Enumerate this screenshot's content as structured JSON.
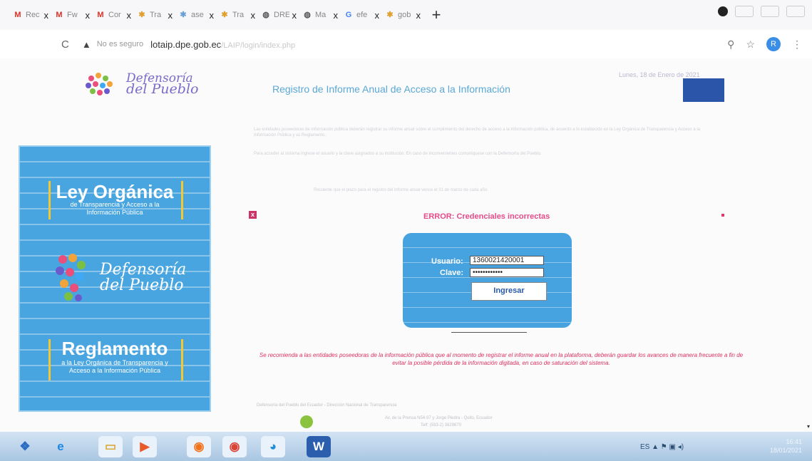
{
  "browser": {
    "tabs": [
      {
        "icon": "gmail-icon",
        "label": "Rec",
        "glyph": "M",
        "color": "#d93025"
      },
      {
        "icon": "gmail-icon",
        "label": "Fw",
        "glyph": "M",
        "color": "#d93025"
      },
      {
        "icon": "gmail-icon",
        "label": "Cor",
        "glyph": "M",
        "color": "#d93025"
      },
      {
        "icon": "site-icon",
        "label": "Tra",
        "glyph": "✱",
        "color": "#e0a030"
      },
      {
        "icon": "site-icon",
        "label": "ase",
        "glyph": "✱",
        "color": "#6aa0d8"
      },
      {
        "icon": "site-icon",
        "label": "Tra",
        "glyph": "✱",
        "color": "#e0a030"
      },
      {
        "icon": "globe-icon",
        "label": "DRE",
        "glyph": "◍",
        "color": "#555555"
      },
      {
        "icon": "globe-icon",
        "label": "Ma",
        "glyph": "◍",
        "color": "#555555"
      },
      {
        "icon": "google-icon",
        "label": "efe",
        "glyph": "G",
        "color": "#4285f4"
      },
      {
        "icon": "site-icon",
        "label": "gob",
        "glyph": "✱",
        "color": "#e0a030"
      }
    ],
    "tab_close": "x",
    "new_tab": "+",
    "reload": "C",
    "security_icon": "▲",
    "security_text": "No es seguro",
    "url_domain": "lotaip.dpe.gob.ec",
    "url_path": "/LAIP/login/index.php",
    "search_icon": "⚲",
    "star_icon": "☆",
    "profile_initial": "R",
    "menu_icon": "⋮"
  },
  "header": {
    "logo_line1": "Defensoría",
    "logo_line2": "del Pueblo",
    "title": "Registro de Informe Anual de Acceso a la Información",
    "date": "Lunes, 18 de Enero de 2021"
  },
  "paragraphs": [
    "Las entidades poseedoras de información pública deberán registrar su informe anual sobre el cumplimiento del derecho de acceso a la información pública, de acuerdo a lo establecido en la Ley Orgánica de Transparencia y Acceso a la Información Pública y su Reglamento.",
    "Para acceder al sistema ingrese el usuario y la clave asignados a su institución. En caso de inconvenientes comuníquese con la Defensoría del Pueblo.",
    "Recuerde que el plazo para el registro del informe anual vence el 31 de marzo de cada año."
  ],
  "banner": {
    "law_title": "Ley Orgánica",
    "law_subtitle": "de Transparencia y Acceso a la Información Pública",
    "brand_line1": "Defensoría",
    "brand_line2": "del Pueblo",
    "reg_title": "Reglamento",
    "reg_subtitle": "a la Ley Orgánica de Transparencia y Acceso a la Información Pública"
  },
  "error": {
    "close_glyph": "x",
    "message": "ERROR: Credenciales incorrectas"
  },
  "login": {
    "user_label": "Usuario:",
    "user_value": "1360021420001",
    "password_label": "Clave:",
    "password_value": "••••••••••••",
    "submit_label": "Ingresar"
  },
  "note": "Se recomienda a las entidades poseedoras de la información pública que al momento de registrar el informe anual en la plataforma, deberán guardar los avances de manera frecuente a fin de evitar la posible pérdida de la información digitada, en caso de saturación del sistema.",
  "footer": {
    "links": "Defensoría del Pueblo del Ecuador - Dirección Nacional de Transparencia",
    "address": "Av. de la Prensa N54-97 y Jorge Piedra - Quito, Ecuador",
    "phone": "Telf: (593-2) 3829670"
  },
  "taskbar": {
    "apps": [
      {
        "name": "start-button",
        "glyph": "❖",
        "color": "#2a6cc4",
        "bg": "transparent"
      },
      {
        "name": "internet-explorer-icon",
        "glyph": "e",
        "color": "#1e88e5",
        "bg": "transparent"
      },
      {
        "name": "file-explorer-icon",
        "glyph": "▭",
        "color": "#d8a93a",
        "bg": "#e9f1fa"
      },
      {
        "name": "media-player-icon",
        "glyph": "▶",
        "color": "#e85a2a",
        "bg": "#e9f1fa"
      },
      {
        "name": "firefox-icon",
        "glyph": "◉",
        "color": "#f2731c",
        "bg": "#e9f1fa"
      },
      {
        "name": "chrome-icon",
        "glyph": "◉",
        "color": "#db4437",
        "bg": "#e9f1fa"
      },
      {
        "name": "edge-icon",
        "glyph": "◕",
        "color": "#1f8fd8",
        "bg": "#e9f1fa"
      },
      {
        "name": "word-icon",
        "glyph": "W",
        "color": "#ffffff",
        "bg": "#2b5fae"
      }
    ],
    "tray_text": "ES  ▲  ⚑  ▣  ◂)",
    "time": "16:41",
    "date": "18/01/2021"
  }
}
